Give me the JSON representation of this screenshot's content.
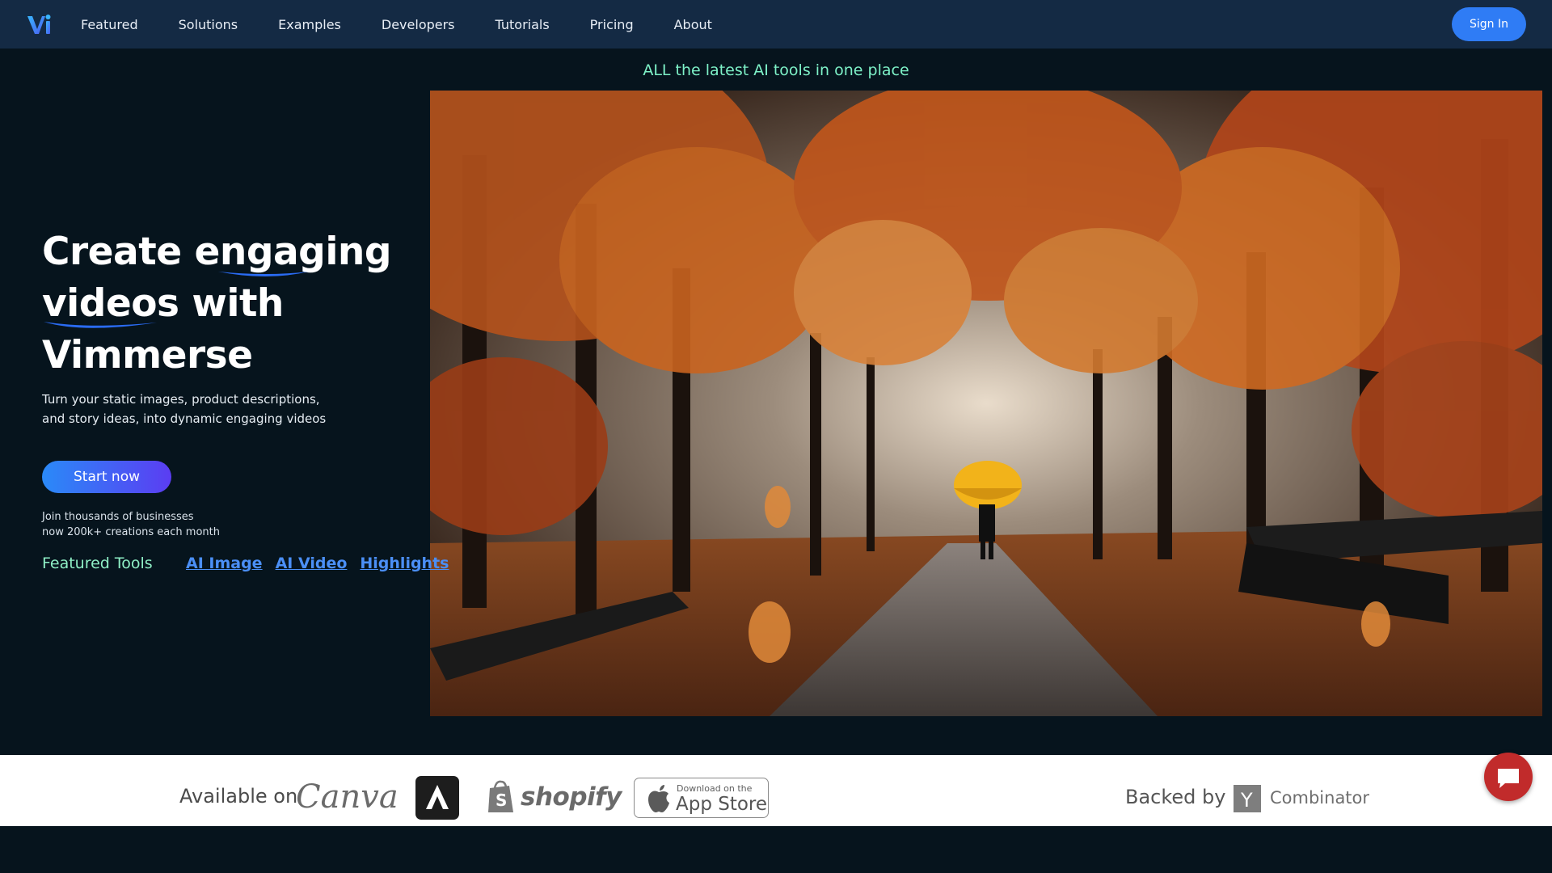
{
  "nav": {
    "logo_alt": "Vi",
    "links": [
      "Featured",
      "Solutions",
      "Examples",
      "Developers",
      "Tutorials",
      "Pricing",
      "About"
    ],
    "sign_in_label": "Sign In"
  },
  "hero": {
    "tagline": "ALL the latest AI tools in one place",
    "headline": {
      "part1": "Create ",
      "highlight1": "engaging",
      "highlight2": "videos",
      "part2": " with",
      "part3": "Vimmerse"
    },
    "subtext_line1": "Turn your static images, product descriptions,",
    "subtext_line2": "and story ideas, into dynamic engaging videos",
    "cta_label": "Start now",
    "social_line1": "Join thousands of businesses",
    "social_line2": "now 200k+ creations each month",
    "featured_label": "Featured Tools",
    "featured_links": [
      "AI Image",
      "AI Video",
      "Highlights"
    ]
  },
  "partners": {
    "available_label": "Available on",
    "canva": "Canva",
    "shopify": "shopify",
    "appstore_small": "Download on the",
    "appstore_big": "App Store",
    "backed_label": "Backed by",
    "yc_letter": "Y",
    "yc_name": "Combinator"
  },
  "colors": {
    "nav_bg": "#142a44",
    "page_bg": "#06141d",
    "accent_blue": "#2f7cf5",
    "tagline_green": "#7ef2c8",
    "link_blue": "#4b8ff6",
    "chat_red": "#c12b2b"
  },
  "icons": {
    "logo": "vi-logo-icon",
    "chat": "chat-bubble-icon",
    "apple": "apple-icon",
    "adobe": "adobe-express-icon",
    "shopify": "shopify-bag-icon"
  }
}
